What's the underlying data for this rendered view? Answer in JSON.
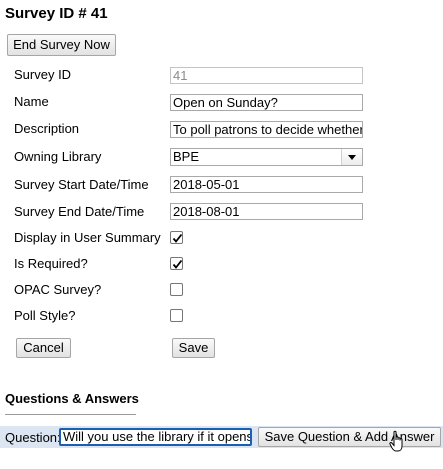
{
  "header": {
    "title": "Survey ID # 41",
    "end_survey_label": "End Survey Now"
  },
  "form": {
    "survey_id": {
      "label": "Survey ID",
      "value": "41"
    },
    "name": {
      "label": "Name",
      "value": "Open on Sunday?"
    },
    "description": {
      "label": "Description",
      "value": "To poll patrons to decide whether"
    },
    "owning_library": {
      "label": "Owning Library",
      "value": "BPE"
    },
    "start_date": {
      "label": "Survey Start Date/Time",
      "value": "2018-05-01"
    },
    "end_date": {
      "label": "Survey End Date/Time",
      "value": "2018-08-01"
    },
    "display_summary": {
      "label": "Display in User Summary",
      "checked": true
    },
    "is_required": {
      "label": "Is Required?",
      "checked": true
    },
    "opac_survey": {
      "label": "OPAC Survey?",
      "checked": false
    },
    "poll_style": {
      "label": "Poll Style?",
      "checked": false
    }
  },
  "actions": {
    "cancel_label": "Cancel",
    "save_label": "Save"
  },
  "questions": {
    "section_title": "Questions & Answers",
    "question_label": "Question:",
    "question_value": "Will you use the library if it opens",
    "save_add_label": "Save Question & Add Answer"
  },
  "icons": {
    "checkmark": "check-icon",
    "dropdown": "chevron-down-icon",
    "cursor": "hand-pointer-icon"
  },
  "colors": {
    "question_bar": "#dce5f2",
    "focus_border": "#1a5fb4"
  }
}
